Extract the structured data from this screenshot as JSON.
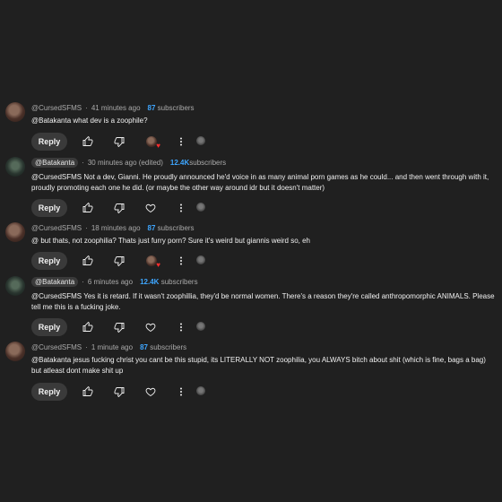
{
  "reply_label": "Reply",
  "comments": [
    {
      "handle": "@CursedSFMS",
      "time": "41 minutes ago",
      "subs_count": "87",
      "subs_word": "subscribers",
      "text": "@Batakanta what dev is a zoophile?",
      "creator_heart": true
    },
    {
      "handle": "@Batakanta",
      "time": "30 minutes ago (edited)",
      "subs_count": "12.4K",
      "subs_word": "subscribers",
      "text": "@CursedSFMS Not a dev, Gianni. He proudly announced he'd voice in as many animal porn games as he could... and then went through with it, proudly promoting each one he did. (or maybe the other way around idr but it doesn't matter)",
      "creator_heart": false
    },
    {
      "handle": "@CursedSFMS",
      "time": "18 minutes ago",
      "subs_count": "87",
      "subs_word": "subscribers",
      "text": "@ but thats, not zoophilia? Thats just furry porn? Sure it's weird but giannis weird so, eh",
      "creator_heart": true
    },
    {
      "handle": "@Batakanta",
      "time": "6 minutes ago",
      "subs_count": "12.4K",
      "subs_word": "subscribers",
      "text": "@CursedSFMS Yes it is retard. If it wasn't zoophillia, they'd be normal women. There's a reason they're called anthropomorphic ANIMALS. Please tell me this is a fucking joke.",
      "creator_heart": false
    },
    {
      "handle": "@CursedSFMS",
      "time": "1 minute ago",
      "subs_count": "87",
      "subs_word": "subscribers",
      "text": "@Batakanta jesus fucking christ you cant be this stupid, its LITERALLY NOT zoophilia, you ALWAYS bitch about shit (which is fine, bags a bag) but atleast dont make shit up",
      "creator_heart": false
    }
  ]
}
